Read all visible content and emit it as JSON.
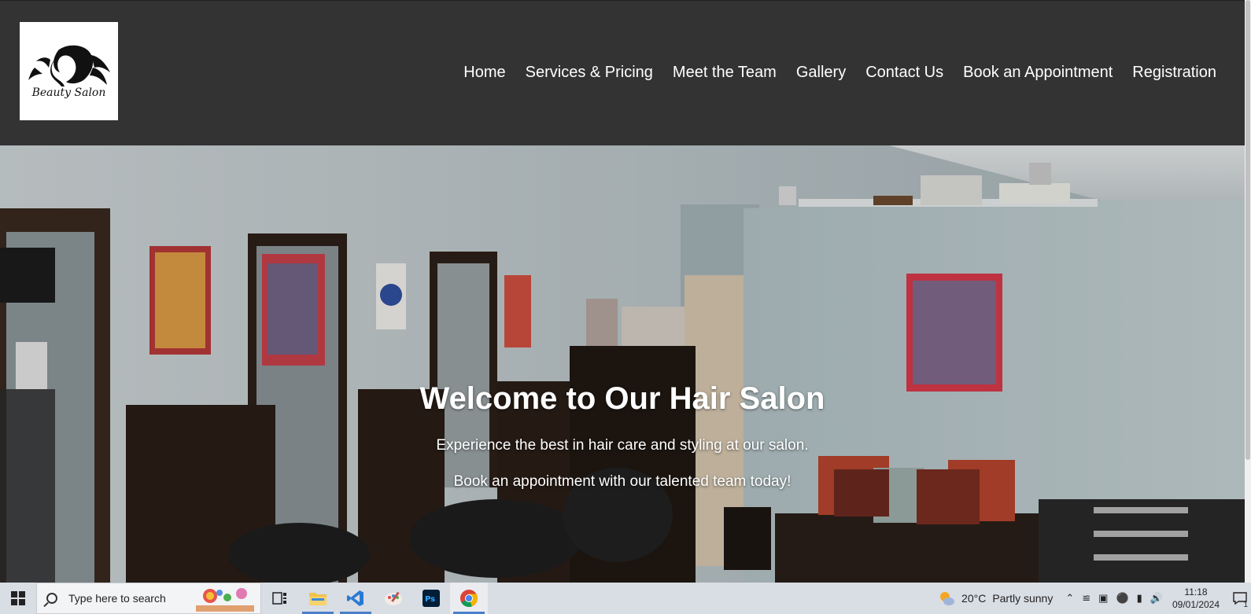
{
  "logo": {
    "text": "Beauty Salon"
  },
  "nav": {
    "items": [
      "Home",
      "Services & Pricing",
      "Meet the Team",
      "Gallery",
      "Contact Us",
      "Book an Appointment",
      "Registration"
    ]
  },
  "hero": {
    "title": "Welcome to Our Hair Salon",
    "line1": "Experience the best in hair care and styling at our salon.",
    "line2": "Book an appointment with our talented team today!"
  },
  "taskbar": {
    "search_placeholder": "Type here to search",
    "weather_temp": "20°C",
    "weather_desc": "Partly sunny",
    "time": "11:18",
    "date": "09/01/2024",
    "notification_count": "1",
    "apps": [
      "task-view",
      "file-explorer",
      "vs-code",
      "paint",
      "photoshop",
      "chrome"
    ],
    "colors": {
      "vscode": "#2a7ad3",
      "chrome_red": "#db4437",
      "chrome_yellow": "#f4b400",
      "chrome_green": "#0f9d58",
      "chrome_blue": "#4285f4",
      "photoshop": "#001e36",
      "photoshop_text": "#31a8ff"
    }
  }
}
